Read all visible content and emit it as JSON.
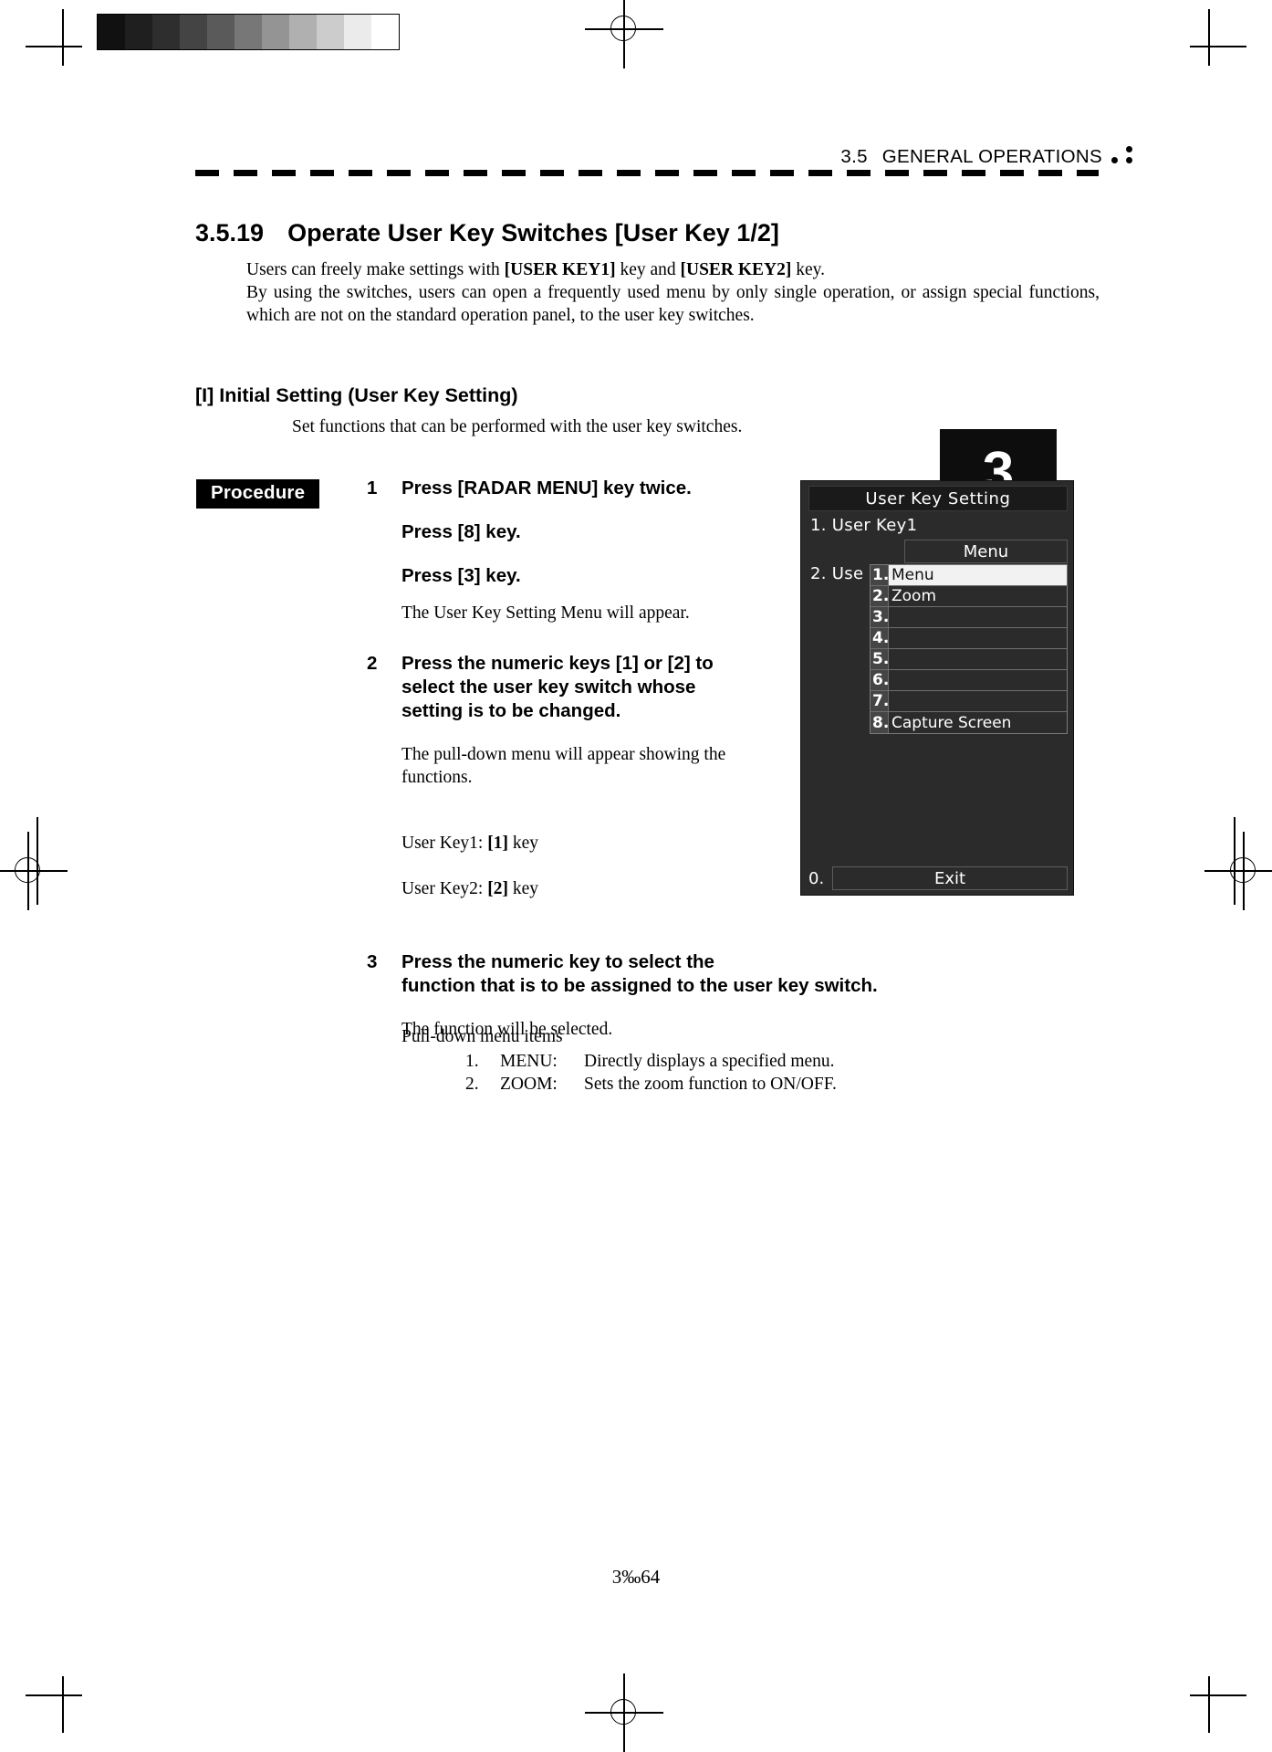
{
  "page": {
    "running_head": {
      "section_number": "3.5",
      "title": "GENERAL OPERATIONS"
    },
    "folio": "3‰64",
    "chapter_tab": "3"
  },
  "grayscale_strip": {
    "name": "grayscale-calibration-bar",
    "swatches": [
      "#111111",
      "#1f1f1f",
      "#2e2e2e",
      "#444444",
      "#5a5a5a",
      "#777777",
      "#949494",
      "#b0b0b0",
      "#cccccc",
      "#ebebeb",
      "#ffffff"
    ]
  },
  "section": {
    "number": "3.5.19",
    "title": "Operate User Key Switches [User Key 1/2]"
  },
  "intro": {
    "line1_a": "Users can freely make settings with ",
    "line1_key1": "[USER KEY1]",
    "line1_b": " key and ",
    "line1_key2": "[USER KEY2]",
    "line1_c": " key.",
    "paragraph": "By using the switches, users can open a frequently used menu by only single operation, or assign special functions, which are not on the standard operation panel, to the user key switches."
  },
  "subsection": {
    "heading": "[I] Initial Setting (User Key Setting)",
    "lead": "Set functions that can be performed with the user key switches."
  },
  "procedure": {
    "badge": "Procedure",
    "steps": [
      {
        "number": "1",
        "bold_lines": [
          "Press [RADAR MENU] key twice.",
          "Press [8] key.",
          "Press [3] key."
        ],
        "note": "The User Key Setting Menu will appear."
      },
      {
        "number": "2",
        "bold_lines": [
          "Press the numeric keys [1] or [2] to\nselect the user key switch whose\nsetting is to be changed."
        ],
        "note": "The pull-down menu will appear showing the\nfunctions.",
        "key_map": [
          {
            "label": "User Key1: ",
            "key": "[1]",
            "suffix": " key"
          },
          {
            "label": "User Key2: ",
            "key": "[2]",
            "suffix": " key"
          }
        ]
      },
      {
        "number": "3",
        "bold_lines": [
          "Press the numeric key to select the\nfunction that is to be assigned to the user key switch."
        ],
        "note": "The function will be selected."
      }
    ]
  },
  "pulldown": {
    "title": "Pull-down menu items",
    "items": [
      {
        "index": "1.",
        "name": "MENU:",
        "description": "Directly displays a specified menu."
      },
      {
        "index": "2.",
        "name": "ZOOM:",
        "description": "Sets the zoom function to ON/OFF."
      }
    ]
  },
  "lcd": {
    "title": "User  Key  Setting",
    "row_user_key1": "1. User  Key1",
    "row_user_key2": "2. Use",
    "value_bar": "Menu",
    "dropdown": [
      {
        "index": "1.",
        "label": "Menu",
        "selected": true
      },
      {
        "index": "2.",
        "label": "Zoom",
        "selected": false
      },
      {
        "index": "3.",
        "label": "",
        "selected": false
      },
      {
        "index": "4.",
        "label": "",
        "selected": false
      },
      {
        "index": "5.",
        "label": "",
        "selected": false
      },
      {
        "index": "6.",
        "label": "",
        "selected": false
      },
      {
        "index": "7.",
        "label": "",
        "selected": false
      },
      {
        "index": "8.",
        "label": "Capture  Screen",
        "selected": false
      }
    ],
    "exit_index": "0.",
    "exit_label": "Exit"
  }
}
